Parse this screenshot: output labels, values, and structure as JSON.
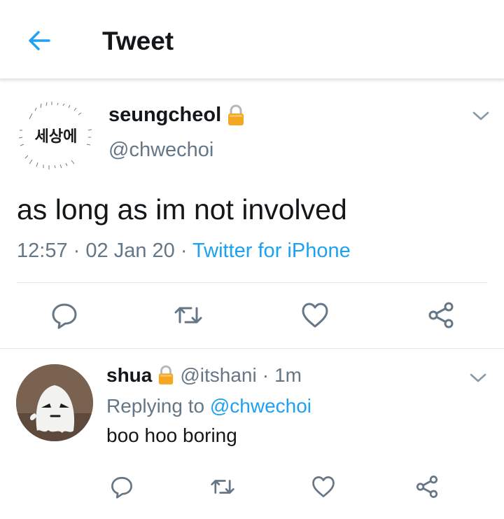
{
  "header": {
    "title": "Tweet"
  },
  "main_tweet": {
    "author": "seungcheol",
    "handle": "@chwechoi",
    "avatar_text": "세상에",
    "text": "as long as im not involved",
    "time": "12:57",
    "date": "02 Jan 20",
    "source": "Twitter for iPhone",
    "sep": "·"
  },
  "reply_tweet": {
    "author": "shua",
    "handle": "@itshani",
    "time": "1m",
    "sep": "·",
    "replying_label": "Replying to",
    "replying_to": "@chwechoi",
    "text": "boo hoo boring"
  },
  "colors": {
    "accent": "#1da1f2",
    "text": "#14171a",
    "muted": "#657786",
    "divider": "#e1e8ed",
    "lock": "#f5a623"
  },
  "icons": [
    "back-arrow-icon",
    "lock-icon",
    "chevron-down-icon",
    "reply-icon",
    "retweet-icon",
    "like-icon",
    "share-icon"
  ]
}
